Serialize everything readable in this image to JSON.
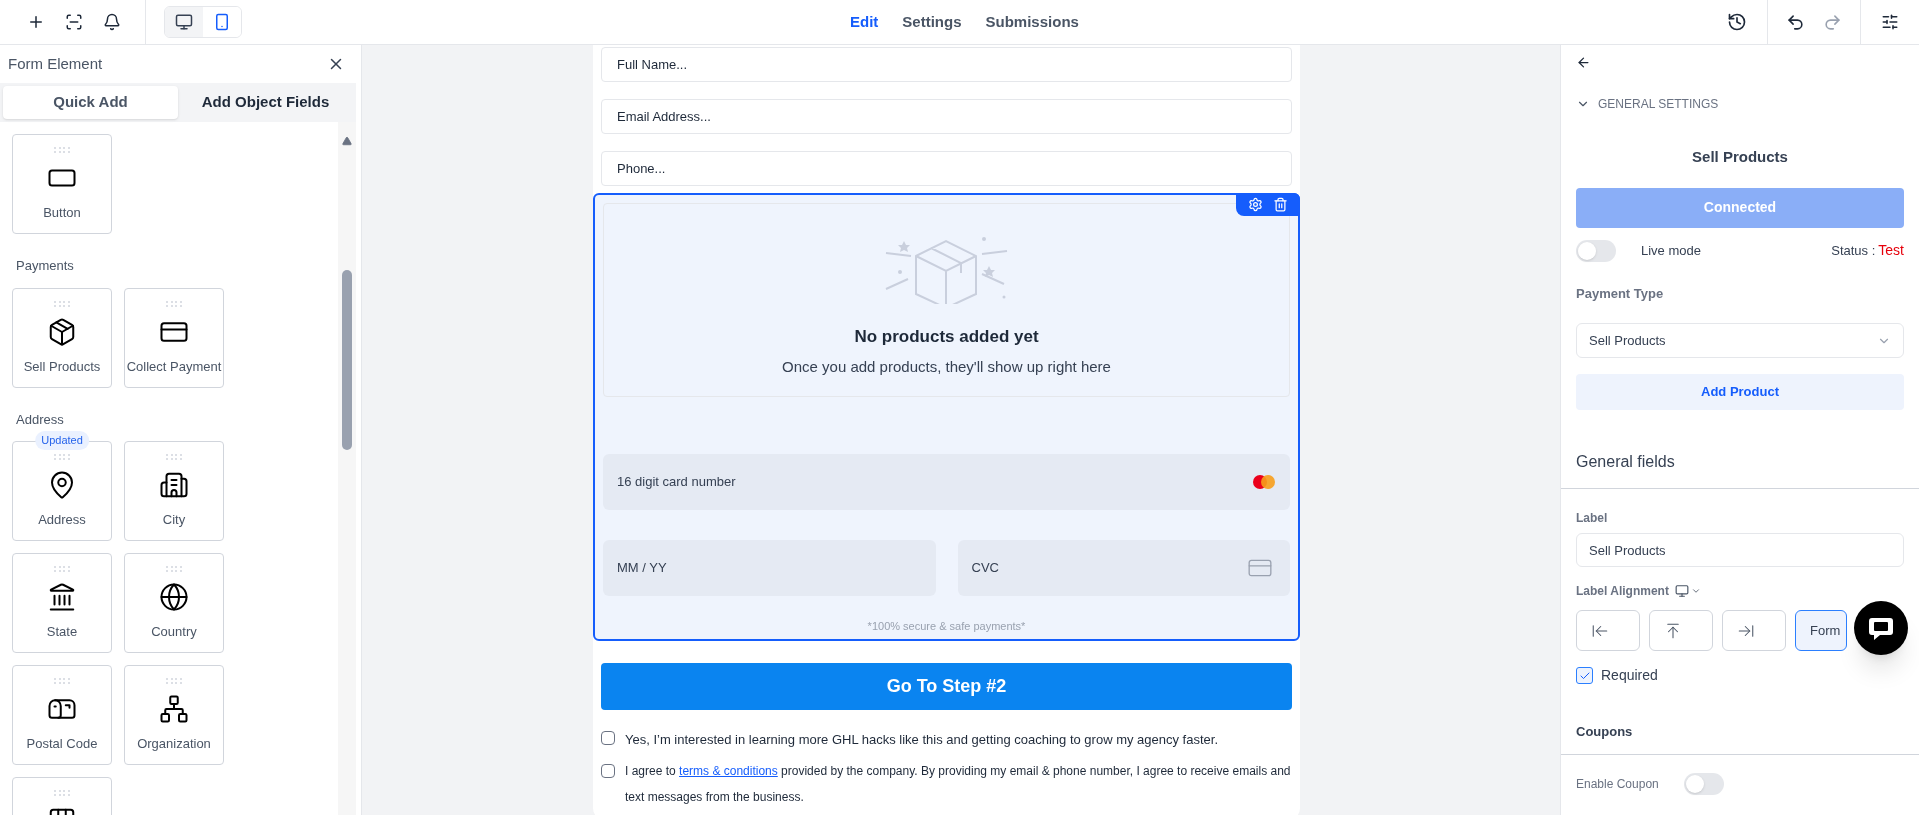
{
  "toolbar": {
    "devices": [
      {
        "kind": "desktop",
        "selected": false
      },
      {
        "kind": "mobile",
        "selected": true
      }
    ]
  },
  "tabs": [
    {
      "label": "Edit",
      "selected": true
    },
    {
      "label": "Settings",
      "selected": false
    },
    {
      "label": "Submissions",
      "selected": false
    }
  ],
  "left_panel": {
    "title": "Form Element",
    "tabs": [
      {
        "label": "Quick Add",
        "selected": true
      },
      {
        "label": "Add Object Fields",
        "selected": false
      }
    ],
    "sections": [
      {
        "cards": [
          {
            "kind": "labeled",
            "label": "Button"
          }
        ]
      },
      {
        "title": "Payments",
        "cards": [
          {
            "kind": "labeled",
            "label": "Sell Products"
          },
          {
            "kind": "labeled",
            "label": "Collect Payment"
          }
        ]
      },
      {
        "title": "Address",
        "cards": [
          {
            "kind": "labeled",
            "label": "Address",
            "badge": "Updated"
          },
          {
            "kind": "labeled",
            "label": "City"
          },
          {
            "kind": "labeled",
            "label": "State"
          },
          {
            "kind": "labeled",
            "label": "Country"
          },
          {
            "kind": "labeled",
            "label": "Postal Code"
          },
          {
            "kind": "labeled",
            "label": "Organization"
          },
          {
            "kind": "cut_off"
          }
        ]
      }
    ]
  },
  "form": {
    "fields": [
      {
        "placeholder": "Full Name..."
      },
      {
        "placeholder": "Email Address..."
      },
      {
        "placeholder": "Phone..."
      }
    ],
    "payment": {
      "empty_title": "No products added yet",
      "empty_text": "Once you add products, they'll show up right here",
      "card_number": "16 digit card number",
      "expiry": "MM / YY",
      "cvc": "CVC",
      "secure_note": "*100% secure & safe payments*"
    },
    "submit": "Go To Step #2",
    "consents": [
      {
        "text": "Yes, I’m interested in learning more GHL hacks like this and getting coaching to grow my agency faster.",
        "checked": false
      },
      {
        "before": "I agree to",
        "link": "terms & conditions",
        "after": "provided by the company. By providing my email & phone number, I agree to receive emails and text messages from the business.",
        "checked": false
      }
    ]
  },
  "right_panel": {
    "section": "GENERAL SETTINGS",
    "title": "Sell Products",
    "connect_button": "Connected",
    "live_mode": {
      "label": "Live mode",
      "on": false
    },
    "status_label": "Status :",
    "status_value": "Test",
    "payment_type_label": "Payment Type",
    "payment_type": "Sell Products",
    "add_product": "Add Product",
    "general_fields": "General fields",
    "label_label": "Label",
    "label_value": "Sell Products",
    "label_alignment": "Label Alignment",
    "alignments": [
      {
        "kind": "left",
        "selected": false
      },
      {
        "kind": "top",
        "selected": false
      },
      {
        "kind": "right",
        "selected": false
      },
      {
        "kind": "text",
        "label": "Form",
        "selected": true
      }
    ],
    "required": {
      "label": "Required",
      "checked": true
    },
    "coupons": "Coupons",
    "enable_coupon": {
      "label": "Enable Coupon",
      "on": false
    }
  }
}
